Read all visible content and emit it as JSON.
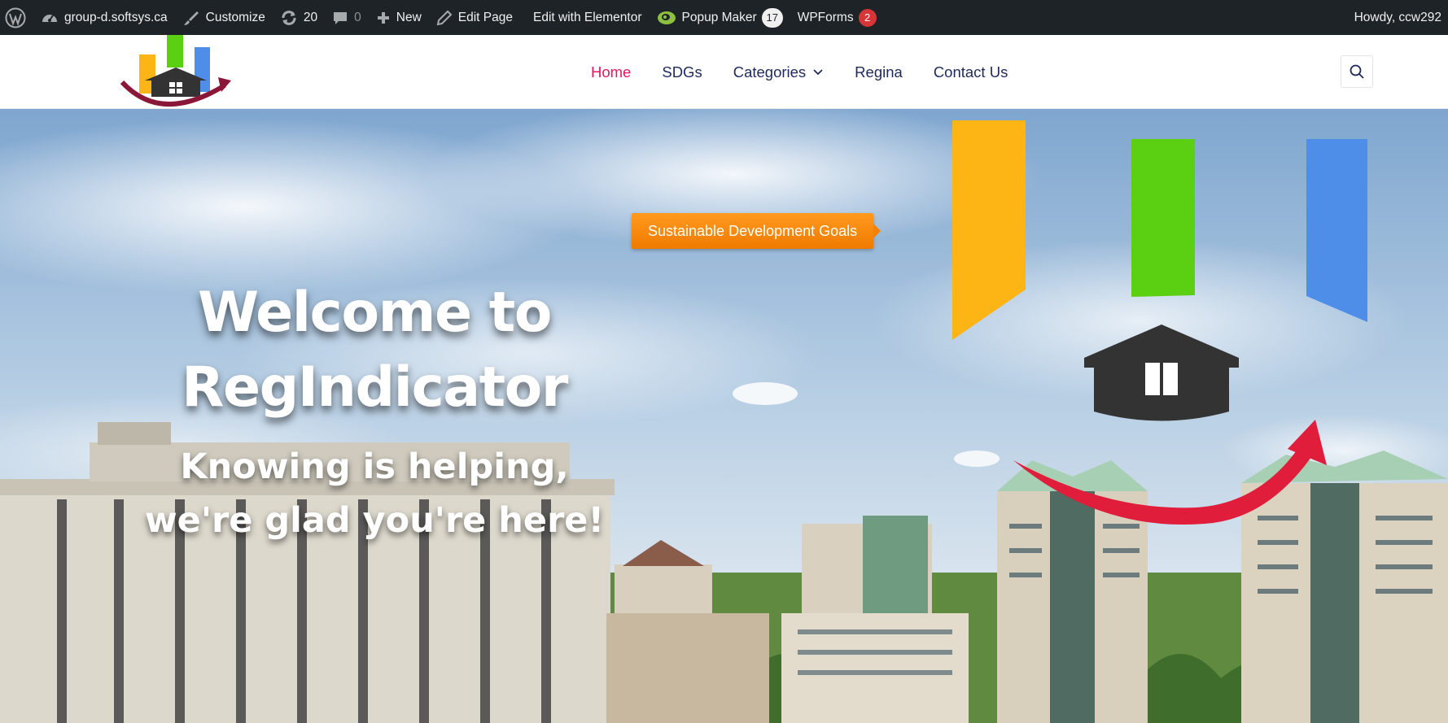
{
  "admin_bar": {
    "site_name": "group-d.softsys.ca",
    "customize": "Customize",
    "updates_count": "20",
    "comments_count": "0",
    "new": "New",
    "edit_page": "Edit Page",
    "edit_elementor": "Edit with Elementor",
    "popup_maker": "Popup Maker",
    "popup_maker_count": "17",
    "wpforms": "WPForms",
    "wpforms_count": "2",
    "howdy": "Howdy, ccw292"
  },
  "nav": {
    "items": [
      {
        "label": "Home",
        "active": true
      },
      {
        "label": "SDGs"
      },
      {
        "label": "Categories",
        "has_dropdown": true
      },
      {
        "label": "Regina"
      },
      {
        "label": "Contact Us"
      }
    ]
  },
  "hero": {
    "badge": "Sustainable Development Goals",
    "title_line1": "Welcome to",
    "title_line2": "RegIndicator",
    "subtitle_line1": "Knowing is helping,",
    "subtitle_line2": "we're glad you're here!"
  },
  "colors": {
    "admin_bg": "#1d2327",
    "nav_active": "#e8175d",
    "nav_text": "#1f2a5c",
    "bar_yellow": "#fdb515",
    "bar_green": "#5bd012",
    "bar_blue": "#4f8ee8",
    "arrow_red": "#e01e3c",
    "house_dark": "#333333",
    "badge_orange": "#f58a07"
  },
  "icons": {
    "wordpress": "wordpress-icon",
    "dashboard": "dashboard-icon",
    "customize": "brush-icon",
    "updates": "refresh-icon",
    "comments": "comment-icon",
    "new": "plus-icon",
    "edit": "pencil-icon",
    "popup": "popup-maker-icon",
    "search": "search-icon",
    "dropdown": "chevron-down-icon"
  }
}
